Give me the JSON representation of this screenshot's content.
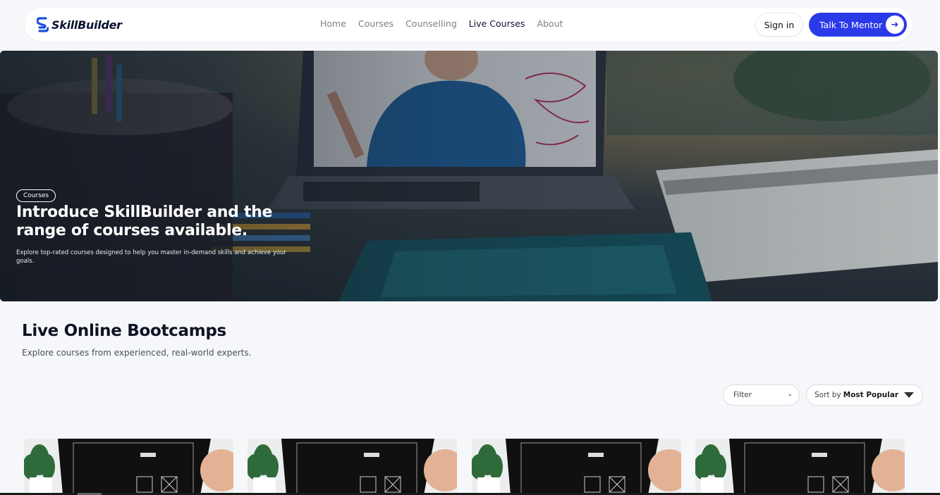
{
  "brand": {
    "name": "SkillBuilder",
    "icon": "skillbuilder-logo-icon"
  },
  "nav": {
    "items": [
      {
        "label": "Home"
      },
      {
        "label": "Courses"
      },
      {
        "label": "Counselling"
      },
      {
        "label": "Live Courses",
        "active": true
      },
      {
        "label": "About"
      }
    ],
    "sign_in": "Sign in",
    "cta": "Talk To Mentor",
    "cta_icon": "arrow-right-icon"
  },
  "hero": {
    "badge": "Courses",
    "title": "Introduce SkillBuilder and the range of courses available.",
    "subtitle": "Explore top-rated courses designed to help you master in-demand skills and achieve your goals."
  },
  "section": {
    "title": "Live Online Bootcamps",
    "subtitle": "Explore courses from experienced, real-world experts."
  },
  "controls": {
    "filter_label": "Filter",
    "sort_prefix": "Sort by",
    "sort_value": "Most Popular"
  },
  "colors": {
    "accent": "#2b3ae8",
    "nav_active": "#0c1330",
    "page_bg": "#f6f7fa"
  }
}
